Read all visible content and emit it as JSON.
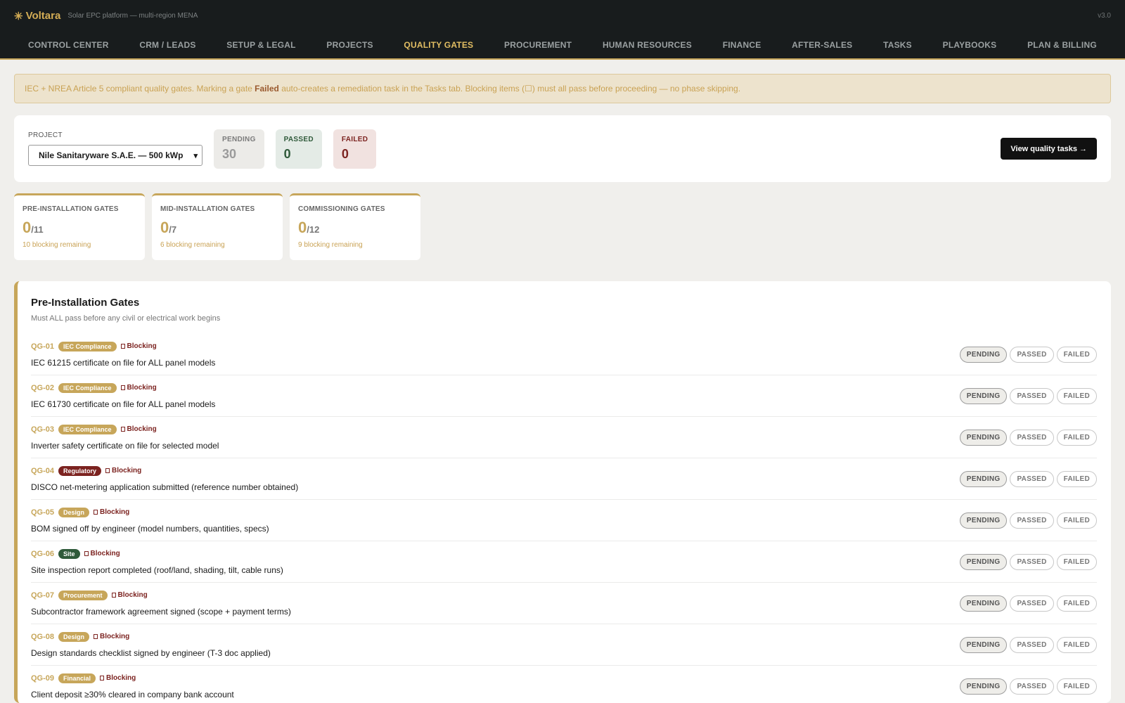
{
  "app": {
    "name": "Voltara",
    "icon": "sun-icon",
    "glyph": "✳",
    "subtitle": "Solar EPC platform — multi-region MENA",
    "version": "v3.0"
  },
  "nav": [
    {
      "label": "CONTROL CENTER",
      "active": false
    },
    {
      "label": "CRM / LEADS",
      "active": false
    },
    {
      "label": "SETUP & LEGAL",
      "active": false
    },
    {
      "label": "PROJECTS",
      "active": false
    },
    {
      "label": "QUALITY GATES",
      "active": true
    },
    {
      "label": "PROCUREMENT",
      "active": false
    },
    {
      "label": "HUMAN RESOURCES",
      "active": false
    },
    {
      "label": "FINANCE",
      "active": false
    },
    {
      "label": "AFTER-SALES",
      "active": false
    },
    {
      "label": "TASKS",
      "active": false
    },
    {
      "label": "PLAYBOOKS",
      "active": false
    },
    {
      "label": "PLAN & BILLING",
      "active": false
    }
  ],
  "notice": {
    "before": "IEC + NREA Article 5 compliant quality gates. Marking a gate ",
    "bold": "Failed",
    "after": " auto-creates a remediation task in the Tasks tab. Blocking items (☐) must all pass before proceeding — no phase skipping."
  },
  "filter": {
    "project_label": "PROJECT",
    "project_value": "Nile Sanitaryware S.A.E. — 500 kWp",
    "stats": {
      "pending_label": "PENDING",
      "pending_value": "30",
      "passed_label": "PASSED",
      "passed_value": "0",
      "failed_label": "FAILED",
      "failed_value": "0"
    },
    "tasks_button": "View quality tasks →"
  },
  "summary": [
    {
      "title": "PRE-INSTALLATION GATES",
      "done": "0",
      "total": "/11",
      "note": "10 blocking remaining"
    },
    {
      "title": "MID-INSTALLATION GATES",
      "done": "0",
      "total": "/7",
      "note": "6 blocking remaining"
    },
    {
      "title": "COMMISSIONING GATES",
      "done": "0",
      "total": "/12",
      "note": "9 blocking remaining"
    }
  ],
  "section": {
    "title": "Pre-Installation Gates",
    "subtitle": "Must ALL pass before any civil or electrical work begins",
    "blocking_label": "Blocking",
    "buttons": {
      "pending": "PENDING",
      "passed": "PASSED",
      "failed": "FAILED"
    },
    "tag_colors": {
      "IEC Compliance": "#c7a65a",
      "Regulatory": "#7c2320",
      "Design": "#c7a65a",
      "Site": "#2f5a3a",
      "Procurement": "#c7a65a",
      "Financial": "#c7a65a"
    },
    "gates": [
      {
        "id": "QG-01",
        "tag": "IEC Compliance",
        "text": "IEC 61215 certificate on file for ALL panel models",
        "status": "pending"
      },
      {
        "id": "QG-02",
        "tag": "IEC Compliance",
        "text": "IEC 61730 certificate on file for ALL panel models",
        "status": "pending"
      },
      {
        "id": "QG-03",
        "tag": "IEC Compliance",
        "text": "Inverter safety certificate on file for selected model",
        "status": "pending"
      },
      {
        "id": "QG-04",
        "tag": "Regulatory",
        "text": "DISCO net-metering application submitted (reference number obtained)",
        "status": "pending"
      },
      {
        "id": "QG-05",
        "tag": "Design",
        "text": "BOM signed off by engineer (model numbers, quantities, specs)",
        "status": "pending"
      },
      {
        "id": "QG-06",
        "tag": "Site",
        "text": "Site inspection report completed (roof/land, shading, tilt, cable runs)",
        "status": "pending"
      },
      {
        "id": "QG-07",
        "tag": "Procurement",
        "text": "Subcontractor framework agreement signed (scope + payment terms)",
        "status": "pending"
      },
      {
        "id": "QG-08",
        "tag": "Design",
        "text": "Design standards checklist signed by engineer (T-3 doc applied)",
        "status": "pending"
      },
      {
        "id": "QG-09",
        "tag": "Financial",
        "text": "Client deposit ≥30% cleared in company bank account",
        "status": "pending"
      }
    ]
  }
}
